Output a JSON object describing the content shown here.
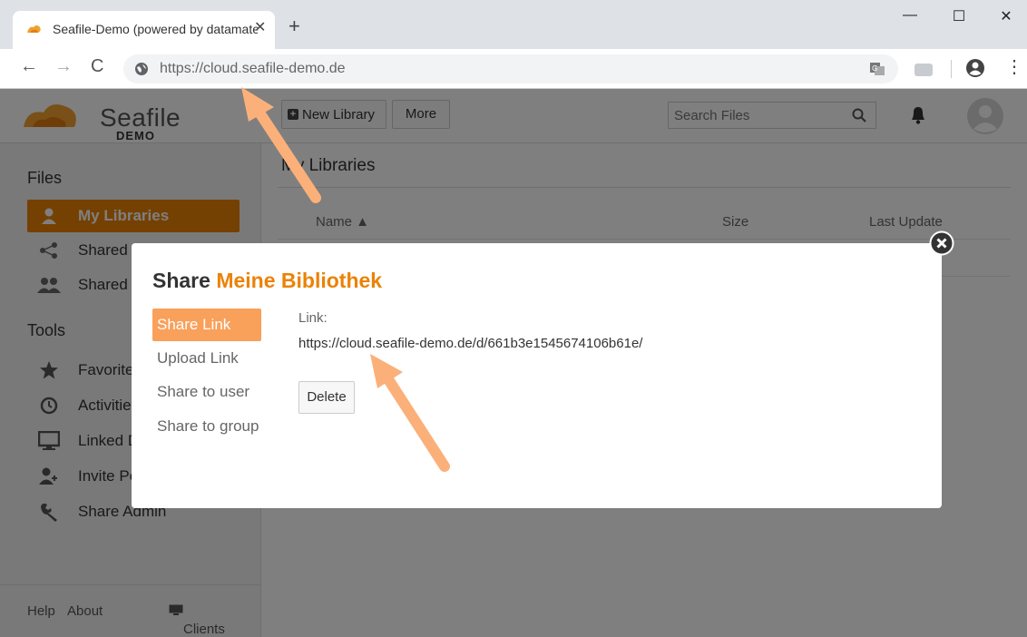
{
  "browser": {
    "tab_title": "Seafile-Demo (powered by datamate)",
    "tab_close": "✕",
    "new_tab": "+",
    "url_host": "https://cloud.seafile-demo.de",
    "window_controls": {
      "minimize": "—",
      "maximize": "☐",
      "close": "✕"
    },
    "nav": {
      "back": "←",
      "forward": "→",
      "reload": "C"
    },
    "menu": "⋮"
  },
  "header": {
    "logo_text": "Seafile",
    "logo_sub": "DEMO",
    "new_library": "New Library",
    "more": "More",
    "search_placeholder": "Search Files"
  },
  "sidebar": {
    "files_heading": "Files",
    "tools_heading": "Tools",
    "file_items": [
      {
        "label": "My Libraries",
        "icon": "user-icon"
      },
      {
        "label": "Shared with me",
        "icon": "share-icon"
      },
      {
        "label": "Shared with groups",
        "icon": "group-icon"
      }
    ],
    "tool_items": [
      {
        "label": "Favorites",
        "icon": "star-icon"
      },
      {
        "label": "Activities",
        "icon": "history-icon"
      },
      {
        "label": "Linked Devices",
        "icon": "monitor-icon"
      },
      {
        "label": "Invite People",
        "icon": "add-user-icon"
      },
      {
        "label": "Share Admin",
        "icon": "wrench-icon"
      }
    ],
    "footer": {
      "help": "Help",
      "about": "About",
      "clients": "Clients"
    }
  },
  "main": {
    "title": "My Libraries",
    "columns": {
      "name": "Name ▲",
      "size": "Size",
      "last_update": "Last Update"
    }
  },
  "modal": {
    "title_prefix": "Share",
    "library_name": "Meine Bibliothek",
    "tabs": [
      "Share Link",
      "Upload Link",
      "Share to user",
      "Share to group"
    ],
    "active_tab": "Share Link",
    "link_label": "Link:",
    "link_value": "https://cloud.seafile-demo.de/d/661b3e1545674106b61e/",
    "delete": "Delete"
  },
  "colors": {
    "accent": "#eb8205",
    "tab_active": "#f9a05b",
    "annotation_arrow": "#fbb07a"
  }
}
